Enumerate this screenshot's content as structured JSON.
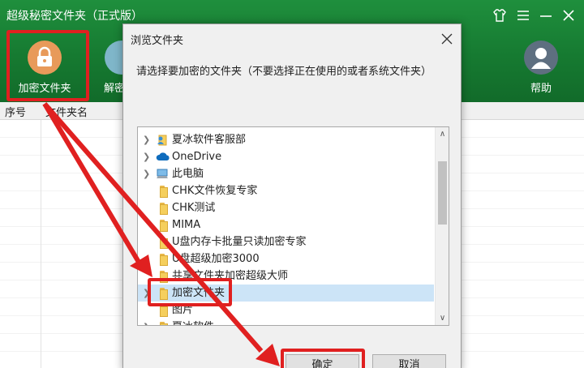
{
  "app": {
    "title": "超级秘密文件夹（正式版）",
    "toolbar": [
      {
        "label": "加密文件夹",
        "icon": "lock-icon"
      },
      {
        "label": "解密",
        "icon": "unlock-icon"
      },
      {
        "label": "帮助",
        "icon": "user-icon"
      }
    ],
    "columns": [
      "序号",
      "文件夹名"
    ],
    "window_controls": [
      "shirt-icon",
      "menu-icon",
      "minimize-icon",
      "close-icon"
    ]
  },
  "dialog": {
    "title": "浏览文件夹",
    "instruction": "请选择要加密的文件夹（不要选择正在使用的或者系统文件夹）",
    "tree": [
      {
        "label": "夏冰软件客服部",
        "icon": "user-folder-icon",
        "expandable": true
      },
      {
        "label": "OneDrive",
        "icon": "cloud-icon",
        "expandable": true
      },
      {
        "label": "此电脑",
        "icon": "computer-icon",
        "expandable": true
      },
      {
        "label": "CHK文件恢复专家",
        "icon": "folder-icon",
        "expandable": false
      },
      {
        "label": "CHK测试",
        "icon": "folder-icon",
        "expandable": false
      },
      {
        "label": "MIMA",
        "icon": "folder-icon",
        "expandable": false
      },
      {
        "label": "U盘内存卡批量只读加密专家",
        "icon": "folder-icon",
        "expandable": true
      },
      {
        "label": "U盘超级加密3000",
        "icon": "folder-icon",
        "expandable": true
      },
      {
        "label": "共享文件夹加密超级大师",
        "icon": "folder-icon",
        "expandable": true
      },
      {
        "label": "加密文件夹",
        "icon": "folder-icon",
        "expandable": true,
        "selected": true
      },
      {
        "label": "图片",
        "icon": "folder-icon",
        "expandable": false
      },
      {
        "label": "夏冰软件",
        "icon": "folder-icon",
        "expandable": true
      }
    ],
    "ok_label": "确定",
    "cancel_label": "取消"
  },
  "colors": {
    "header_green": "#1b8438",
    "highlight_red": "#e02020",
    "selection_blue": "#cce4f7"
  }
}
